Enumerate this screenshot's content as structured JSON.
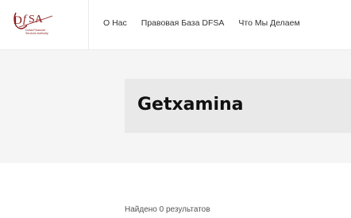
{
  "header": {
    "logo": {
      "letters": "DFSA",
      "tagline": [
        "Dubai Financial",
        "Services Authority"
      ],
      "color": "#8b1a1a"
    },
    "nav": [
      {
        "label": "О Нас"
      },
      {
        "label": "Правовая База DFSA"
      },
      {
        "label": "Что Мы Делаем"
      }
    ]
  },
  "hero": {
    "title": "Getxamina"
  },
  "results": {
    "summary": "Найдено 0 результатов"
  }
}
